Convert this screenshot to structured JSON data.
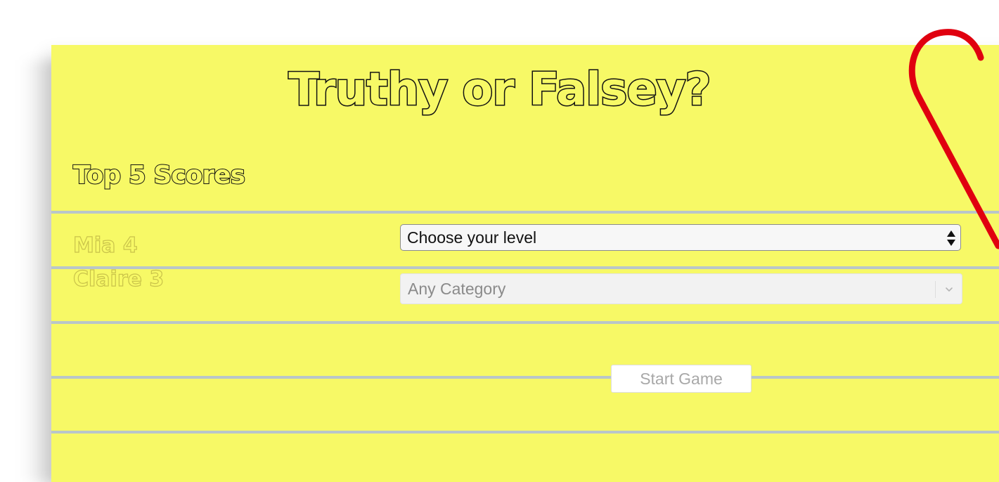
{
  "app": {
    "title": "Truthy or Falsey?"
  },
  "scores": {
    "heading": "Top 5 Scores",
    "entries": [
      "Mia 4",
      "Claire 3"
    ]
  },
  "controls": {
    "level_select": {
      "value": "Choose your level"
    },
    "category_select": {
      "value": "Any Category"
    },
    "start_button": {
      "label": "Start Game"
    }
  },
  "colors": {
    "paper": "#f7f966",
    "rule_line": "#b9c6c9",
    "paperclip": "#e0000f"
  },
  "icons": {
    "level_select_arrows": "updown-arrows-icon",
    "category_chevron": "chevron-down-icon",
    "decoration": "paperclip-icon"
  }
}
